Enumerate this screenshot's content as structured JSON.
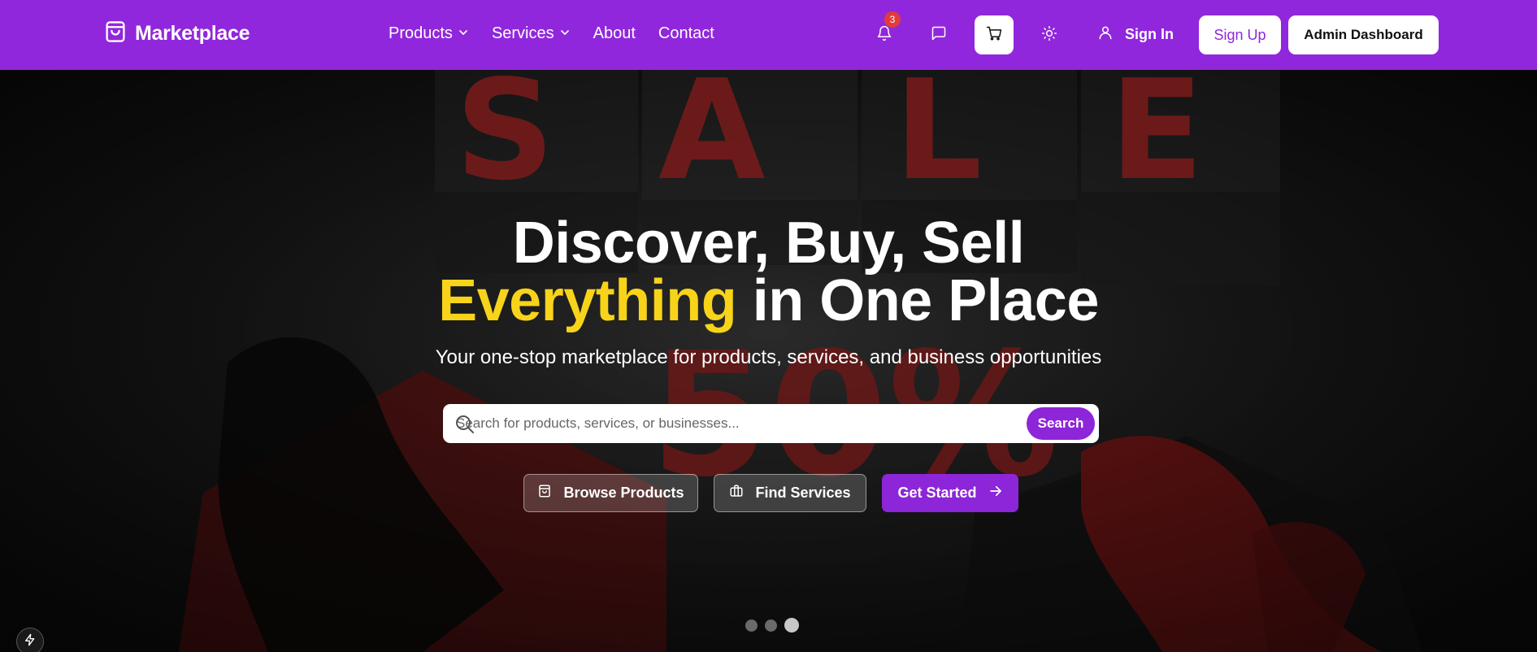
{
  "brand": {
    "name": "Marketplace"
  },
  "nav": {
    "items": [
      {
        "label": "Products",
        "has_dropdown": true
      },
      {
        "label": "Services",
        "has_dropdown": true
      },
      {
        "label": "About",
        "has_dropdown": false
      },
      {
        "label": "Contact",
        "has_dropdown": false
      }
    ],
    "notifications_count": "3",
    "signin_label": "Sign In",
    "signup_label": "Sign Up",
    "admin_label": "Admin Dashboard"
  },
  "hero": {
    "banner_letters": [
      "S",
      "A",
      "L",
      "E"
    ],
    "banner_discount": "50%",
    "headline_line1": "Discover, Buy, Sell",
    "headline_accent": "Everything",
    "headline_rest": " in One Place",
    "subtitle": "Your one-stop marketplace for products, services, and business opportunities",
    "search": {
      "placeholder": "Search for products, services, or businesses...",
      "value": "",
      "button_label": "Search"
    },
    "actions": [
      {
        "label": "Browse Products",
        "icon": "shopping-bag-icon"
      },
      {
        "label": "Find Services",
        "icon": "briefcase-icon"
      },
      {
        "label": "Get Started",
        "icon": "arrow-right-icon"
      }
    ],
    "carousel": {
      "slides": 3,
      "active_index": 2
    }
  },
  "colors": {
    "brand_purple": "#9127dc",
    "accent_yellow": "#f7d31a",
    "notification_red": "#e23b3b"
  }
}
